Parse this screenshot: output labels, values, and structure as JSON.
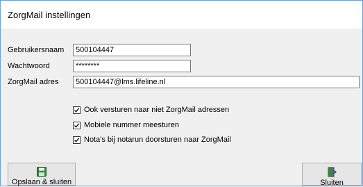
{
  "window": {
    "title": "ZorgMail instellingen"
  },
  "form": {
    "username_label": "Gebruikersnaam",
    "username_value": "500104447",
    "password_label": "Wachtwoord",
    "password_value": "********",
    "address_label": "ZorgMail adres",
    "address_value": "500104447@lms.lifeline.nl"
  },
  "options": [
    {
      "label": "Ook versturen naar niet ZorgMail adressen",
      "checked": true
    },
    {
      "label": "Mobiele nummer meesturen",
      "checked": true
    },
    {
      "label": "Nota's bij notarun doorsturen naar ZorgMail",
      "checked": true
    }
  ],
  "buttons": {
    "save_label": "Opslaan & sluiten",
    "save_icon": "floppy-disk-icon",
    "close_label": "Sluiten",
    "close_icon": "exit-door-icon"
  },
  "colors": {
    "window_border": "#6d9fd6",
    "background": "#f0f0f0",
    "save_icon": "#2e8b3a"
  }
}
